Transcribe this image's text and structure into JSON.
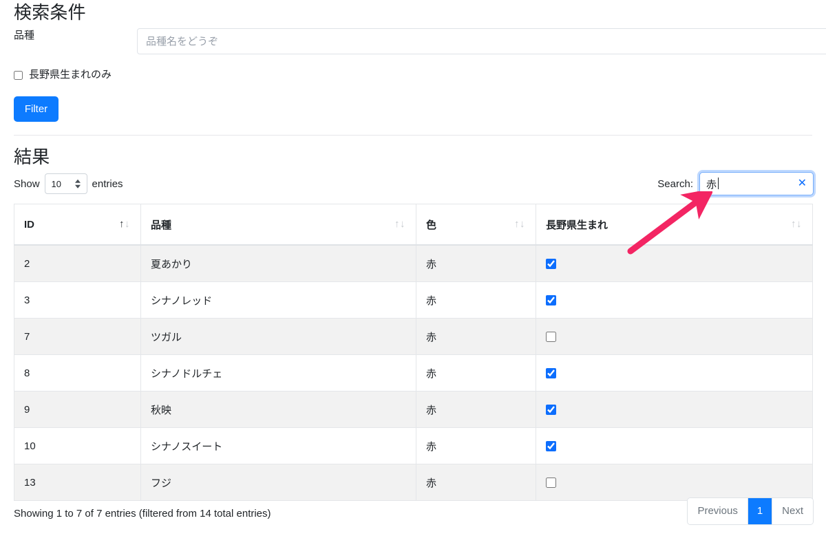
{
  "filter_panel": {
    "title": "検索条件",
    "breed_label": "品種",
    "breed_placeholder": "品種名をどうぞ",
    "breed_value": "",
    "nagano_only_label": "長野県生まれのみ",
    "nagano_only_checked": false,
    "filter_button": "Filter"
  },
  "results": {
    "title": "結果",
    "show_prefix": "Show",
    "page_length": "10",
    "show_suffix": "entries",
    "search_label": "Search:",
    "search_value": "赤",
    "clear_icon": "close-icon",
    "info": "Showing 1 to 7 of 7 entries (filtered from 14 total entries)",
    "columns": [
      {
        "label": "ID",
        "sort": "asc"
      },
      {
        "label": "品種",
        "sort": "none"
      },
      {
        "label": "色",
        "sort": "none"
      },
      {
        "label": "長野県生まれ",
        "sort": "none"
      }
    ],
    "rows": [
      {
        "id": "2",
        "name": "夏あかり",
        "color": "赤",
        "nagano": true
      },
      {
        "id": "3",
        "name": "シナノレッド",
        "color": "赤",
        "nagano": true
      },
      {
        "id": "7",
        "name": "ツガル",
        "color": "赤",
        "nagano": false
      },
      {
        "id": "8",
        "name": "シナノドルチェ",
        "color": "赤",
        "nagano": true
      },
      {
        "id": "9",
        "name": "秋映",
        "color": "赤",
        "nagano": true
      },
      {
        "id": "10",
        "name": "シナノスイート",
        "color": "赤",
        "nagano": true
      },
      {
        "id": "13",
        "name": "フジ",
        "color": "赤",
        "nagano": false
      }
    ],
    "pagination": {
      "previous": "Previous",
      "pages": [
        "1"
      ],
      "active_page": "1",
      "next": "Next"
    }
  },
  "annotation": {
    "type": "arrow",
    "points_to": "search-input",
    "color": "#f32563"
  },
  "colors": {
    "accent_blue": "#0d7bff",
    "link_blue": "#0d6efd",
    "row_stripe": "#f2f2f2",
    "border": "#e4e6e9",
    "annotation_pink": "#f32563"
  }
}
